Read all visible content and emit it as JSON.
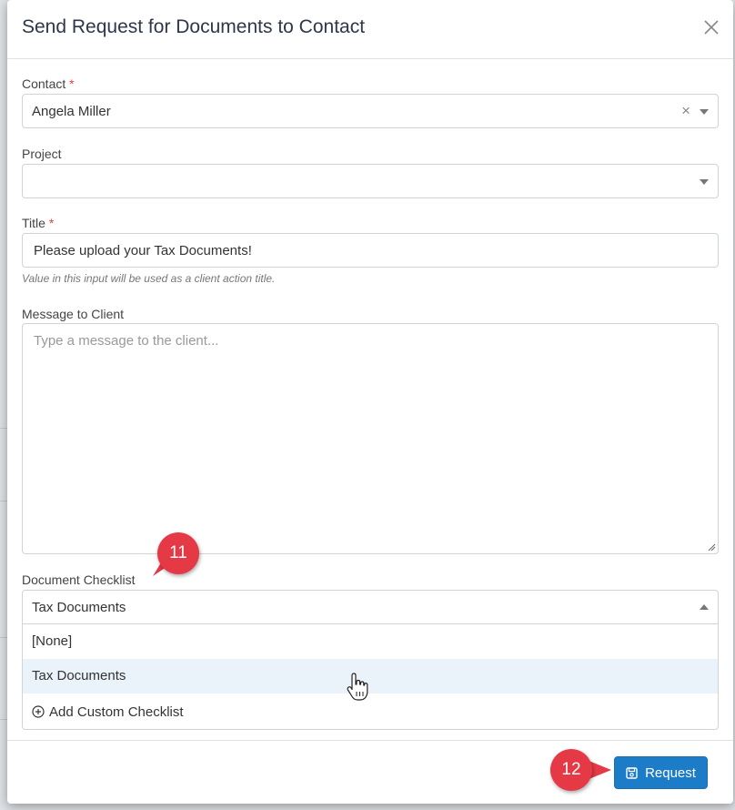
{
  "modal": {
    "title": "Send Request for Documents to Contact"
  },
  "form": {
    "contact": {
      "label": "Contact",
      "required_mark": "*",
      "value": "Angela Miller",
      "clear_glyph": "×"
    },
    "project": {
      "label": "Project",
      "value": ""
    },
    "title": {
      "label": "Title",
      "required_mark": "*",
      "value": "Please upload your Tax Documents!",
      "hint": "Value in this input will be used as a client action title."
    },
    "message": {
      "label": "Message to Client",
      "placeholder": "Type a message to the client..."
    },
    "checklist": {
      "label": "Document Checklist",
      "value": "Tax Documents",
      "options": [
        "[None]",
        "Tax Documents"
      ],
      "add_custom_label": "Add Custom Checklist"
    }
  },
  "footer": {
    "request_label": "Request"
  },
  "callouts": {
    "step_11": "11",
    "step_12": "12",
    "color": "#e63946"
  },
  "colors": {
    "primary_button": "#1d7cc8",
    "required": "#e53e3e",
    "highlight_row": "#eaf2fa"
  }
}
